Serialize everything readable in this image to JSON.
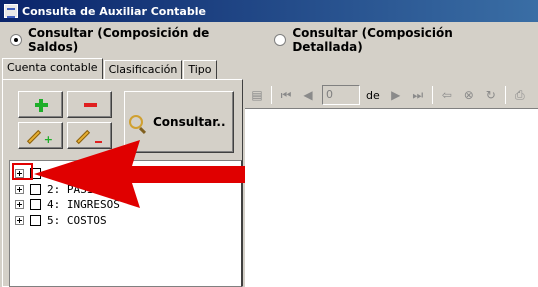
{
  "window": {
    "title": "Consulta de Auxiliar Contable"
  },
  "mode": {
    "options": [
      {
        "label": "Consultar (Composición de Saldos)",
        "selected": true
      },
      {
        "label": "Consultar (Composición Detallada)",
        "selected": false
      }
    ]
  },
  "tabs": [
    {
      "label": "Cuenta contable",
      "active": true
    },
    {
      "label": "Clasificación",
      "active": false
    },
    {
      "label": "Tipo",
      "active": false
    }
  ],
  "actions": {
    "add_icon": "plus-green-icon",
    "delete_icon": "minus-red-icon",
    "edit_add_icon": "pencil-plus-icon",
    "edit_remove_icon": "pencil-minus-icon",
    "consult_label": "Consultar.."
  },
  "tree": {
    "items": [
      {
        "label": "",
        "checked": false
      },
      {
        "label": "2: PASIVO",
        "checked": false
      },
      {
        "label": "4: INGRESOS",
        "checked": false
      },
      {
        "label": "5: COSTOS",
        "checked": false
      }
    ]
  },
  "report_toolbar": {
    "page_value": "0",
    "of_label": "de"
  },
  "colors": {
    "titlebar_start": "#0a246a",
    "titlebar_end": "#3a6ea5",
    "annotation_red": "#e00000",
    "add_green": "#1fae2a"
  }
}
